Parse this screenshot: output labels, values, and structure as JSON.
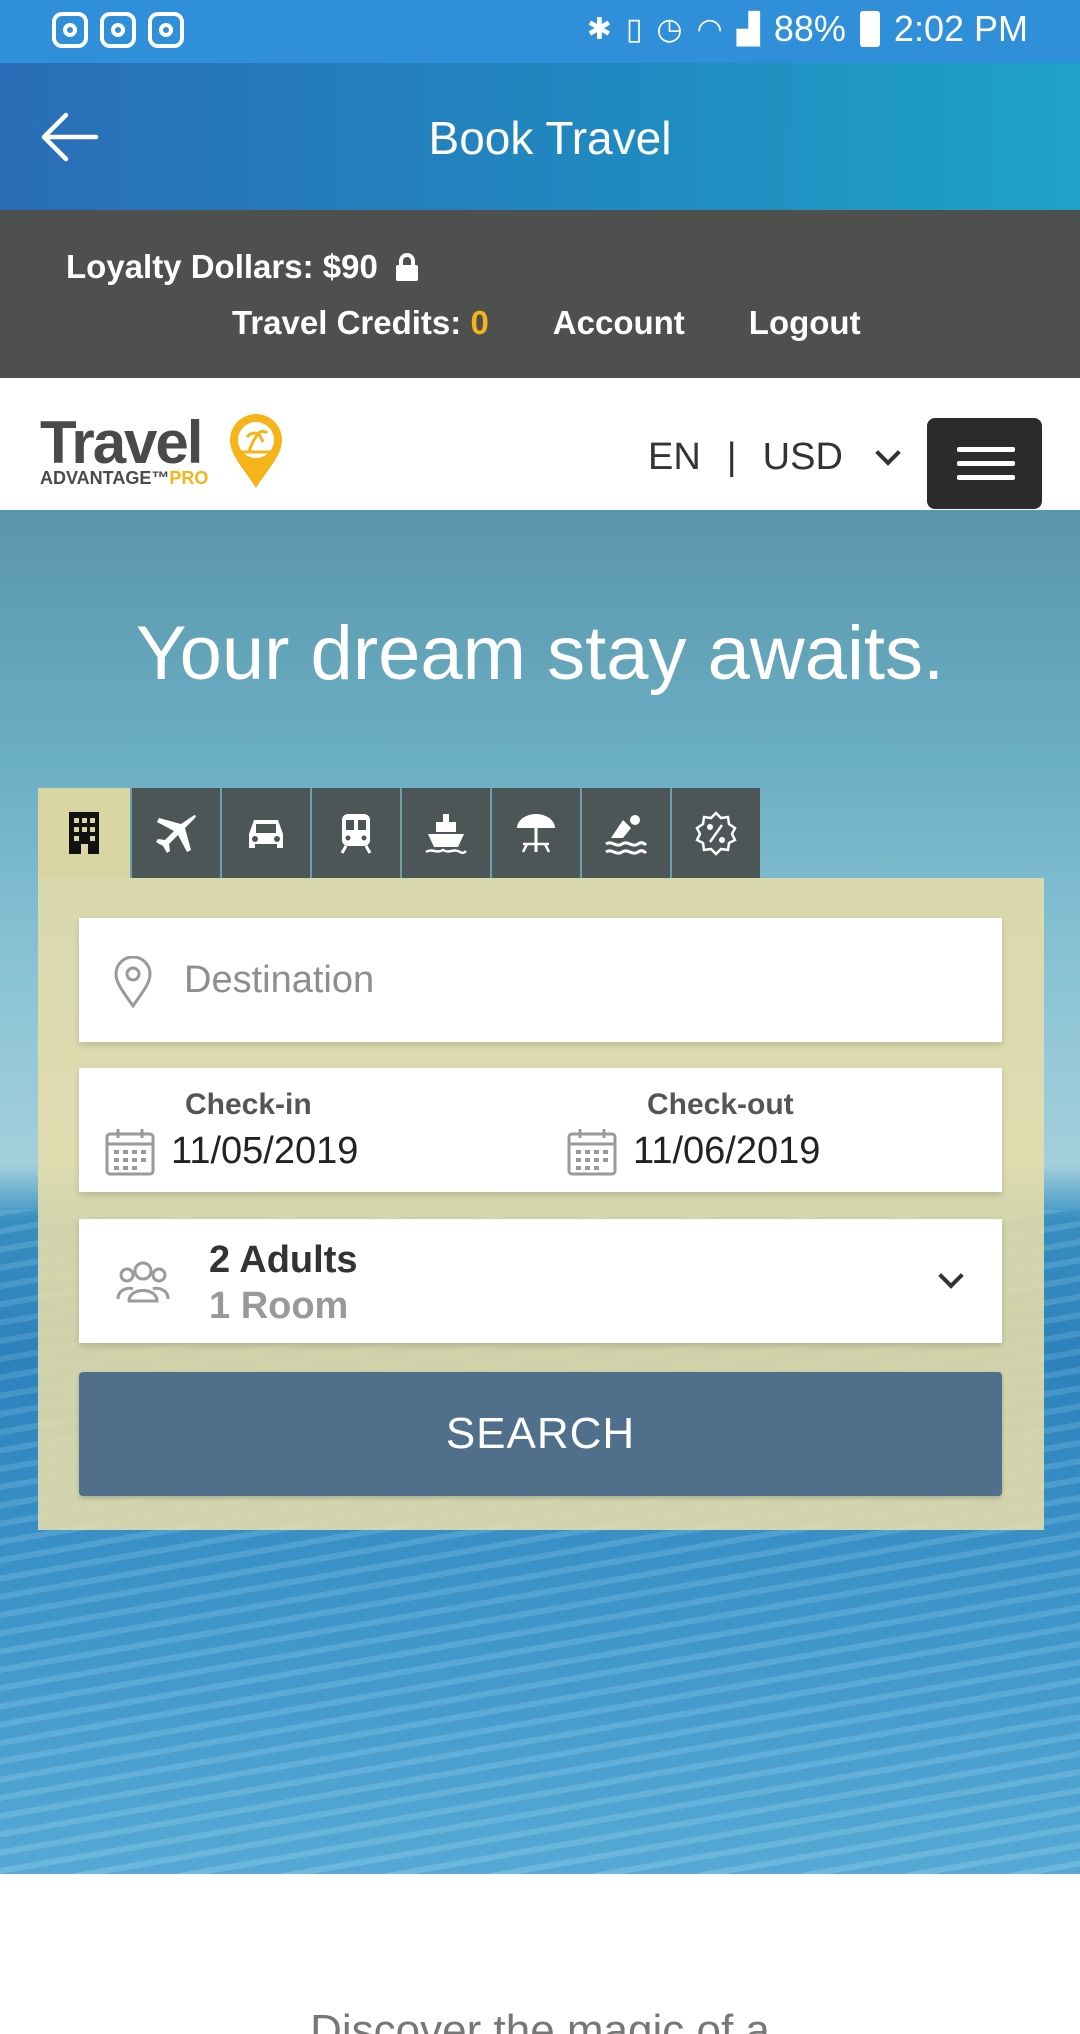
{
  "status_bar": {
    "battery": "88%",
    "time": "2:02 PM"
  },
  "header": {
    "title": "Book Travel"
  },
  "account_bar": {
    "loyalty": "Loyalty Dollars: $90",
    "credits_label": "Travel Credits: ",
    "credits_value": "0",
    "account": "Account",
    "logout": "Logout"
  },
  "brand": {
    "logo_word": "Travel",
    "logo_sub": "ADVANTAGE",
    "logo_tm": "™",
    "logo_pro": "PRO",
    "language": "EN",
    "separator": "|",
    "currency": "USD"
  },
  "hero": {
    "title": "Your dream stay awaits."
  },
  "tabs": [
    "hotels",
    "flights",
    "cars",
    "trains",
    "cruises",
    "vacations",
    "activities",
    "deals"
  ],
  "search": {
    "destination_placeholder": "Destination",
    "checkin_label": "Check-in",
    "checkin_value": "11/05/2019",
    "checkout_label": "Check-out",
    "checkout_value": "11/06/2019",
    "adults": "2 Adults",
    "rooms": "1 Room",
    "button": "SEARCH"
  },
  "footer": {
    "discover": "Discover the magic of a"
  },
  "colors": {
    "status_bar": "#2f8fd8",
    "account_bar": "#4d504d",
    "accent": "#f4b41a",
    "search_button": "#4f6f8b"
  }
}
